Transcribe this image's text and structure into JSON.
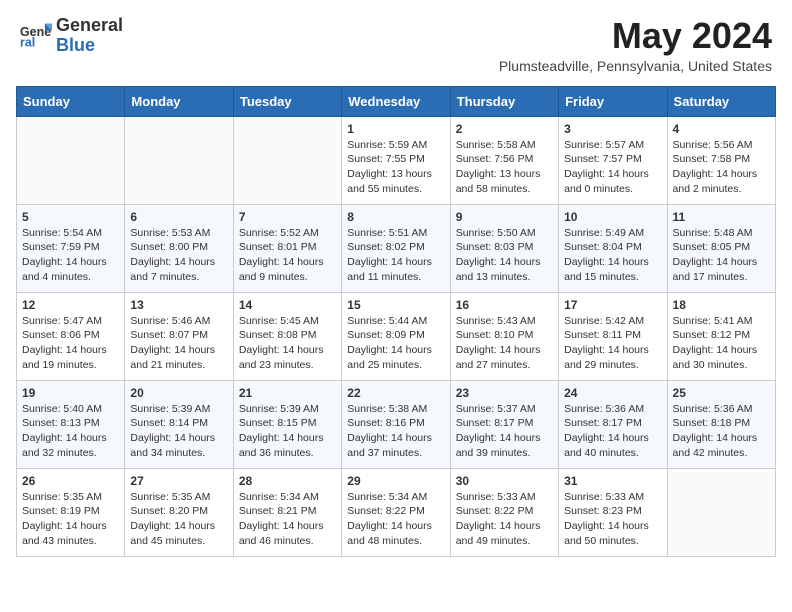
{
  "logo": {
    "general": "General",
    "blue": "Blue"
  },
  "title": "May 2024",
  "subtitle": "Plumsteadville, Pennsylvania, United States",
  "days_of_week": [
    "Sunday",
    "Monday",
    "Tuesday",
    "Wednesday",
    "Thursday",
    "Friday",
    "Saturday"
  ],
  "weeks": [
    [
      {
        "day": "",
        "info": ""
      },
      {
        "day": "",
        "info": ""
      },
      {
        "day": "",
        "info": ""
      },
      {
        "day": "1",
        "info": "Sunrise: 5:59 AM\nSunset: 7:55 PM\nDaylight: 13 hours and 55 minutes."
      },
      {
        "day": "2",
        "info": "Sunrise: 5:58 AM\nSunset: 7:56 PM\nDaylight: 13 hours and 58 minutes."
      },
      {
        "day": "3",
        "info": "Sunrise: 5:57 AM\nSunset: 7:57 PM\nDaylight: 14 hours and 0 minutes."
      },
      {
        "day": "4",
        "info": "Sunrise: 5:56 AM\nSunset: 7:58 PM\nDaylight: 14 hours and 2 minutes."
      }
    ],
    [
      {
        "day": "5",
        "info": "Sunrise: 5:54 AM\nSunset: 7:59 PM\nDaylight: 14 hours and 4 minutes."
      },
      {
        "day": "6",
        "info": "Sunrise: 5:53 AM\nSunset: 8:00 PM\nDaylight: 14 hours and 7 minutes."
      },
      {
        "day": "7",
        "info": "Sunrise: 5:52 AM\nSunset: 8:01 PM\nDaylight: 14 hours and 9 minutes."
      },
      {
        "day": "8",
        "info": "Sunrise: 5:51 AM\nSunset: 8:02 PM\nDaylight: 14 hours and 11 minutes."
      },
      {
        "day": "9",
        "info": "Sunrise: 5:50 AM\nSunset: 8:03 PM\nDaylight: 14 hours and 13 minutes."
      },
      {
        "day": "10",
        "info": "Sunrise: 5:49 AM\nSunset: 8:04 PM\nDaylight: 14 hours and 15 minutes."
      },
      {
        "day": "11",
        "info": "Sunrise: 5:48 AM\nSunset: 8:05 PM\nDaylight: 14 hours and 17 minutes."
      }
    ],
    [
      {
        "day": "12",
        "info": "Sunrise: 5:47 AM\nSunset: 8:06 PM\nDaylight: 14 hours and 19 minutes."
      },
      {
        "day": "13",
        "info": "Sunrise: 5:46 AM\nSunset: 8:07 PM\nDaylight: 14 hours and 21 minutes."
      },
      {
        "day": "14",
        "info": "Sunrise: 5:45 AM\nSunset: 8:08 PM\nDaylight: 14 hours and 23 minutes."
      },
      {
        "day": "15",
        "info": "Sunrise: 5:44 AM\nSunset: 8:09 PM\nDaylight: 14 hours and 25 minutes."
      },
      {
        "day": "16",
        "info": "Sunrise: 5:43 AM\nSunset: 8:10 PM\nDaylight: 14 hours and 27 minutes."
      },
      {
        "day": "17",
        "info": "Sunrise: 5:42 AM\nSunset: 8:11 PM\nDaylight: 14 hours and 29 minutes."
      },
      {
        "day": "18",
        "info": "Sunrise: 5:41 AM\nSunset: 8:12 PM\nDaylight: 14 hours and 30 minutes."
      }
    ],
    [
      {
        "day": "19",
        "info": "Sunrise: 5:40 AM\nSunset: 8:13 PM\nDaylight: 14 hours and 32 minutes."
      },
      {
        "day": "20",
        "info": "Sunrise: 5:39 AM\nSunset: 8:14 PM\nDaylight: 14 hours and 34 minutes."
      },
      {
        "day": "21",
        "info": "Sunrise: 5:39 AM\nSunset: 8:15 PM\nDaylight: 14 hours and 36 minutes."
      },
      {
        "day": "22",
        "info": "Sunrise: 5:38 AM\nSunset: 8:16 PM\nDaylight: 14 hours and 37 minutes."
      },
      {
        "day": "23",
        "info": "Sunrise: 5:37 AM\nSunset: 8:17 PM\nDaylight: 14 hours and 39 minutes."
      },
      {
        "day": "24",
        "info": "Sunrise: 5:36 AM\nSunset: 8:17 PM\nDaylight: 14 hours and 40 minutes."
      },
      {
        "day": "25",
        "info": "Sunrise: 5:36 AM\nSunset: 8:18 PM\nDaylight: 14 hours and 42 minutes."
      }
    ],
    [
      {
        "day": "26",
        "info": "Sunrise: 5:35 AM\nSunset: 8:19 PM\nDaylight: 14 hours and 43 minutes."
      },
      {
        "day": "27",
        "info": "Sunrise: 5:35 AM\nSunset: 8:20 PM\nDaylight: 14 hours and 45 minutes."
      },
      {
        "day": "28",
        "info": "Sunrise: 5:34 AM\nSunset: 8:21 PM\nDaylight: 14 hours and 46 minutes."
      },
      {
        "day": "29",
        "info": "Sunrise: 5:34 AM\nSunset: 8:22 PM\nDaylight: 14 hours and 48 minutes."
      },
      {
        "day": "30",
        "info": "Sunrise: 5:33 AM\nSunset: 8:22 PM\nDaylight: 14 hours and 49 minutes."
      },
      {
        "day": "31",
        "info": "Sunrise: 5:33 AM\nSunset: 8:23 PM\nDaylight: 14 hours and 50 minutes."
      },
      {
        "day": "",
        "info": ""
      }
    ]
  ]
}
